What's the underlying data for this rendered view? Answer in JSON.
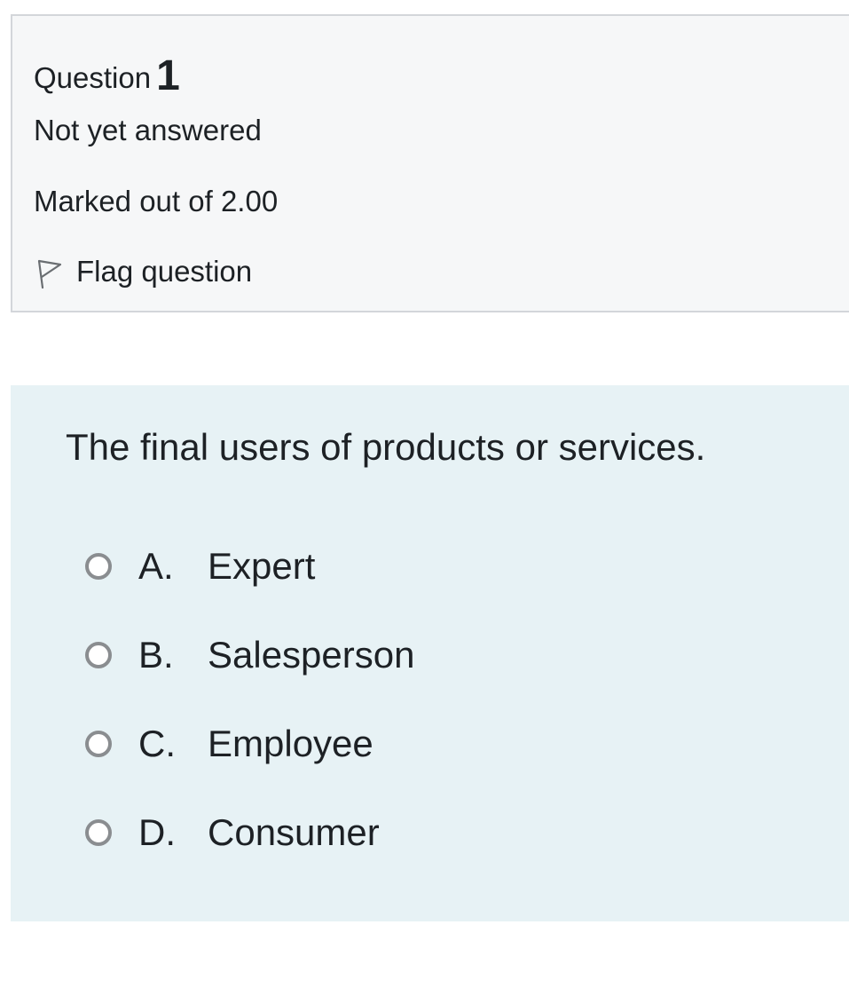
{
  "info": {
    "question_label": "Question",
    "question_number": "1",
    "state": "Not yet answered",
    "grade": "Marked out of 2.00",
    "flag_label": "Flag question"
  },
  "question": {
    "text": "The final users of products or services.",
    "answers": [
      {
        "letter": "A.",
        "text": "Expert"
      },
      {
        "letter": "B.",
        "text": "Salesperson"
      },
      {
        "letter": "C.",
        "text": "Employee"
      },
      {
        "letter": "D.",
        "text": "Consumer"
      }
    ]
  },
  "icons": {
    "flag": "flag-outline-icon",
    "radio": "radio-unchecked-icon"
  },
  "colors": {
    "info_background": "#f6f7f8",
    "info_border": "#d3d6da",
    "content_background": "#e7f2f5",
    "text": "#1d2125",
    "radio_border": "#8a8d90"
  }
}
